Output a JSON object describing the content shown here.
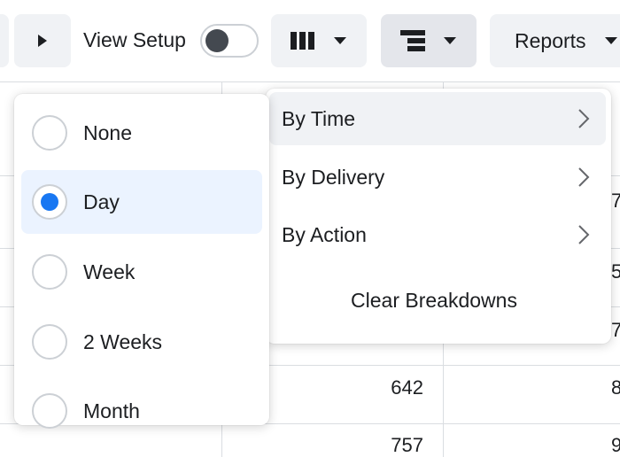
{
  "toolbar": {
    "view_setup_label": "View Setup",
    "view_setup_on": false,
    "reports_label": "Reports",
    "icons": {
      "play": "play-triangle-icon",
      "columns": "columns-icon",
      "breakdown": "breakdown-icon",
      "caret": "caret-down-icon"
    }
  },
  "table": {
    "visible_values": [
      "642",
      "757"
    ],
    "clipped_values": [
      "7",
      "5",
      "7",
      "8",
      "9"
    ]
  },
  "time_menu": {
    "options": [
      {
        "label": "None",
        "selected": false
      },
      {
        "label": "Day",
        "selected": true
      },
      {
        "label": "Week",
        "selected": false
      },
      {
        "label": "2 Weeks",
        "selected": false
      },
      {
        "label": "Month",
        "selected": false
      }
    ]
  },
  "breakdown_menu": {
    "items": [
      {
        "label": "By Time"
      },
      {
        "label": "By Delivery"
      },
      {
        "label": "By Action"
      }
    ],
    "clear_label": "Clear Breakdowns"
  },
  "colors": {
    "accent": "#1877f2",
    "selected_bg": "#ebf3ff",
    "button_bg": "#f0f2f5",
    "text": "#1c1e21",
    "border": "#dadde1"
  }
}
